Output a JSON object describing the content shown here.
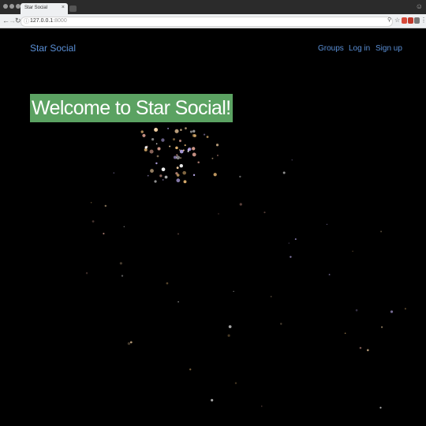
{
  "browser": {
    "tab_title": "Star Social",
    "tab_close": "×",
    "url_host": "127.0.0.1",
    "url_port": ":8000",
    "icons": [
      "back-icon",
      "forward-icon",
      "reload-icon",
      "info-icon",
      "search-icon",
      "star-icon",
      "menu-icon",
      "profile-icon"
    ]
  },
  "navbar": {
    "brand": "Star Social",
    "links": [
      "Groups",
      "Log in",
      "Sign up"
    ]
  },
  "hero": {
    "title": "Welcome to Star Social!"
  },
  "colors": {
    "link": "#5a8fd6",
    "hero_bg": "#5ba262",
    "page_bg": "#000000"
  }
}
